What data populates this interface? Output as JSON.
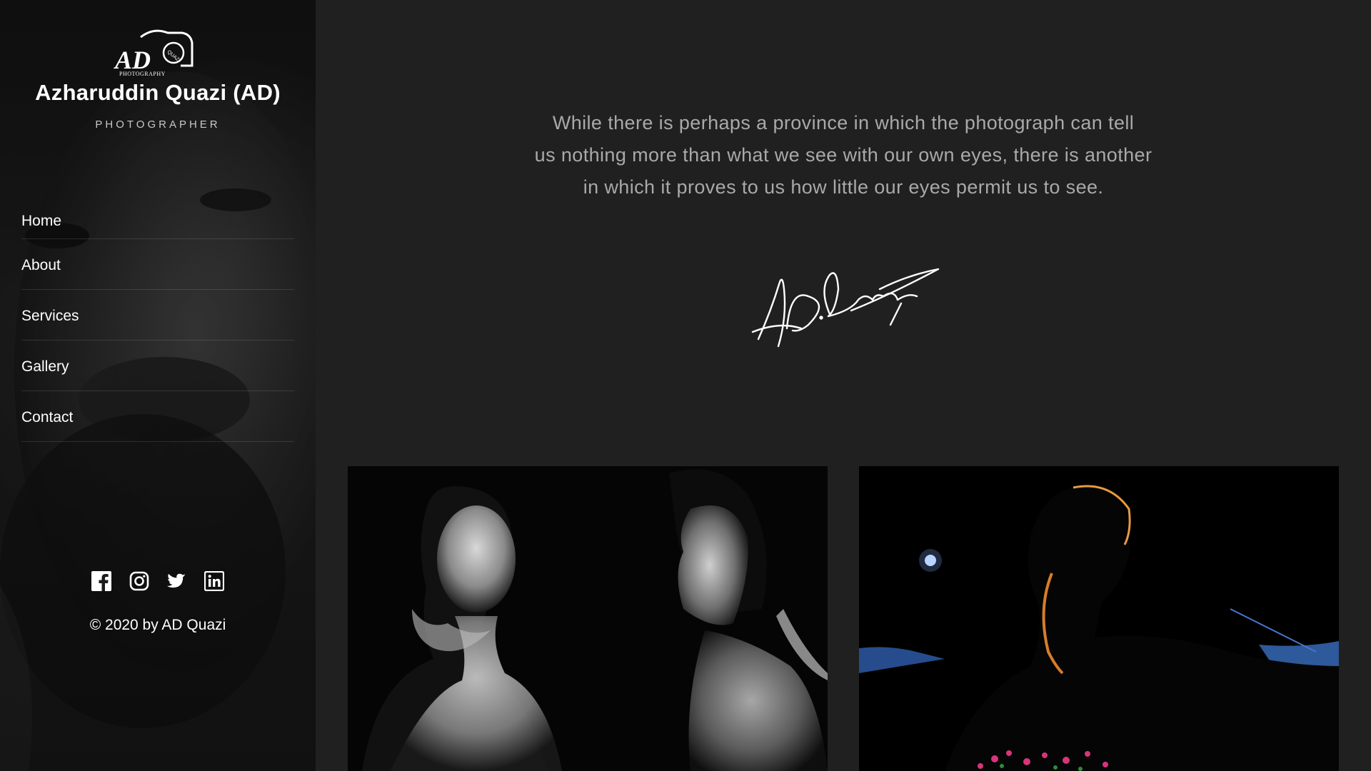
{
  "sidebar": {
    "logo": {
      "text": "AD",
      "caption": "PHOTOGRAPHY",
      "badge": "QUAZI"
    },
    "title": "Azharuddin Quazi (AD)",
    "subtitle": "PHOTOGRAPHER",
    "nav": [
      {
        "label": "Home"
      },
      {
        "label": "About"
      },
      {
        "label": "Services"
      },
      {
        "label": "Gallery"
      },
      {
        "label": "Contact"
      }
    ],
    "social": [
      {
        "icon": "facebook-icon"
      },
      {
        "icon": "instagram-icon"
      },
      {
        "icon": "twitter-icon"
      },
      {
        "icon": "linkedin-icon"
      }
    ],
    "copyright": "© 2020 by AD Quazi"
  },
  "main": {
    "quote_lines": [
      "While there is perhaps a province in which the photograph can tell",
      "us nothing more than what we see with our own eyes, there is another",
      "in which it proves to us how little our eyes permit us to see."
    ],
    "signature": "AD Quazi"
  },
  "colors": {
    "background": "#202020",
    "sidebar": "#1b1b1b",
    "quote_text": "#a9a9a9",
    "text": "#ffffff"
  }
}
